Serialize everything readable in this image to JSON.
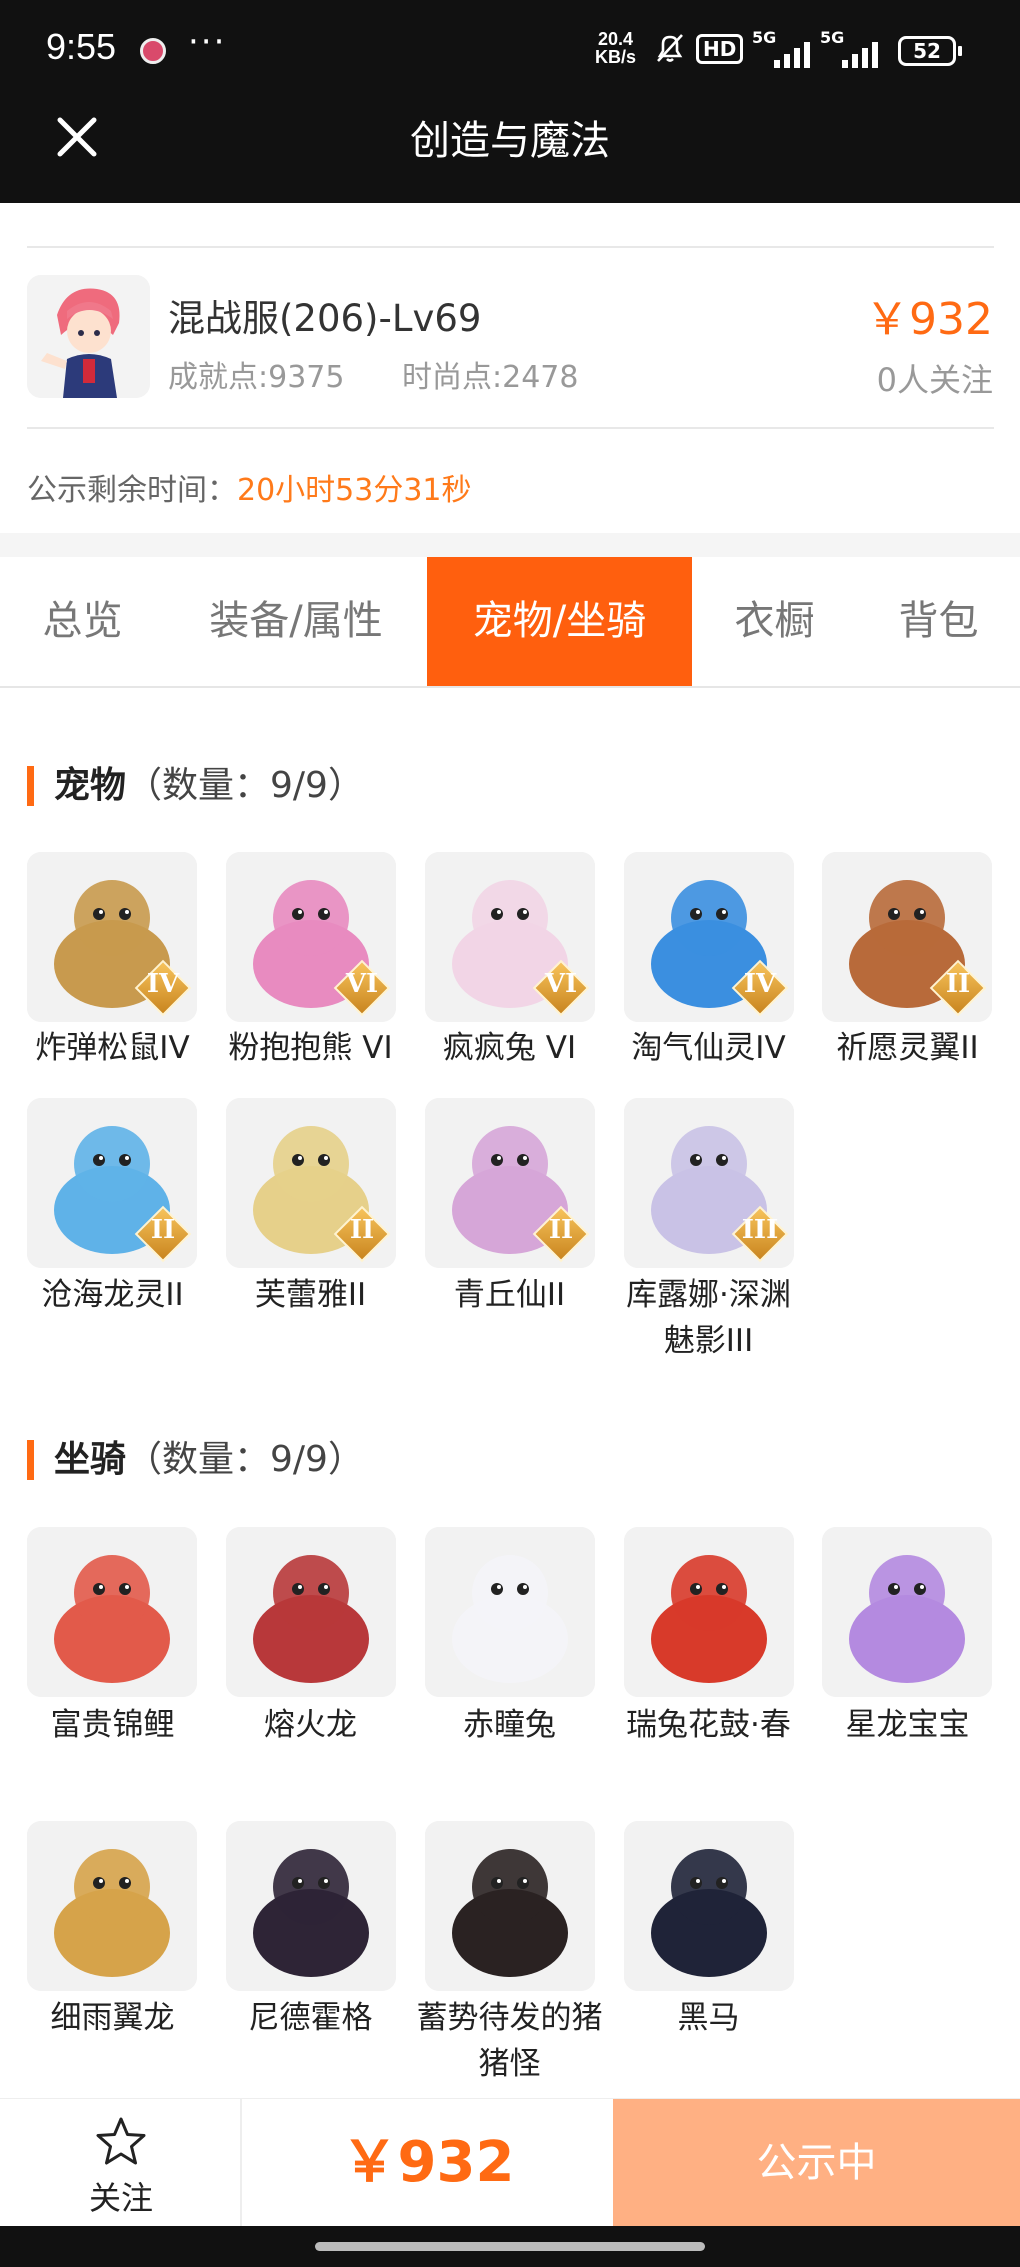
{
  "status_bar": {
    "time": "9:55",
    "net_speed": "20.4",
    "net_unit": "KB/s",
    "hd_label": "HD",
    "signal_1": "5G",
    "signal_2": "5G",
    "battery": "52"
  },
  "header": {
    "title": "创造与魔法",
    "close_icon": "close-icon"
  },
  "listing": {
    "name": "混战服(206)-Lv69",
    "achievement": "成就点:9375",
    "fashion": "时尚点:2478",
    "price": "￥932",
    "followers": "0人关注",
    "countdown_label": "公示剩余时间：",
    "countdown_value": "20小时53分31秒"
  },
  "tabs": [
    {
      "label": "总览",
      "active": false
    },
    {
      "label": "装备/属性",
      "active": false
    },
    {
      "label": "宠物/坐骑",
      "active": true
    },
    {
      "label": "衣橱",
      "active": false
    },
    {
      "label": "背包",
      "active": false
    }
  ],
  "pets": {
    "title": "宠物",
    "count": "（数量：9/9）",
    "items": [
      {
        "name": "炸弹松鼠IV",
        "tier": "IV",
        "color": "#c89a4e"
      },
      {
        "name": "粉抱抱熊 VI",
        "tier": "VI",
        "color": "#e88bc0"
      },
      {
        "name": "疯疯兔 VI",
        "tier": "VI",
        "color": "#f2d5e6"
      },
      {
        "name": "淘气仙灵IV",
        "tier": "IV",
        "color": "#3b8fe0"
      },
      {
        "name": "祈愿灵翼II",
        "tier": "II",
        "color": "#b86a3a"
      },
      {
        "name": "沧海龙灵II",
        "tier": "II",
        "color": "#5fb2e8"
      },
      {
        "name": "芙蕾雅II",
        "tier": "II",
        "color": "#e6d08a"
      },
      {
        "name": "青丘仙II",
        "tier": "II",
        "color": "#d6a6d8"
      },
      {
        "name": "库露娜·深渊魅影III",
        "tier": "III",
        "color": "#c9c2e6"
      }
    ]
  },
  "mounts": {
    "title": "坐骑",
    "count": "（数量：9/9）",
    "items": [
      {
        "name": "富贵锦鲤",
        "color": "#e25a4a"
      },
      {
        "name": "熔火龙",
        "color": "#b8383a"
      },
      {
        "name": "赤瞳兔",
        "color": "#f4f4f8"
      },
      {
        "name": "瑞兔花鼓·春",
        "color": "#d83a2a"
      },
      {
        "name": "星龙宝宝",
        "color": "#b48ae0"
      },
      {
        "name": "细雨翼龙",
        "color": "#d6a34a"
      },
      {
        "name": "尼德霍格",
        "color": "#2e2436"
      },
      {
        "name": "蓄势待发的猪猪怪",
        "color": "#2a2222"
      },
      {
        "name": "黑马",
        "color": "#1f2338"
      }
    ]
  },
  "bottom_bar": {
    "follow_label": "关注",
    "price": "￥932",
    "status_label": "公示中"
  }
}
